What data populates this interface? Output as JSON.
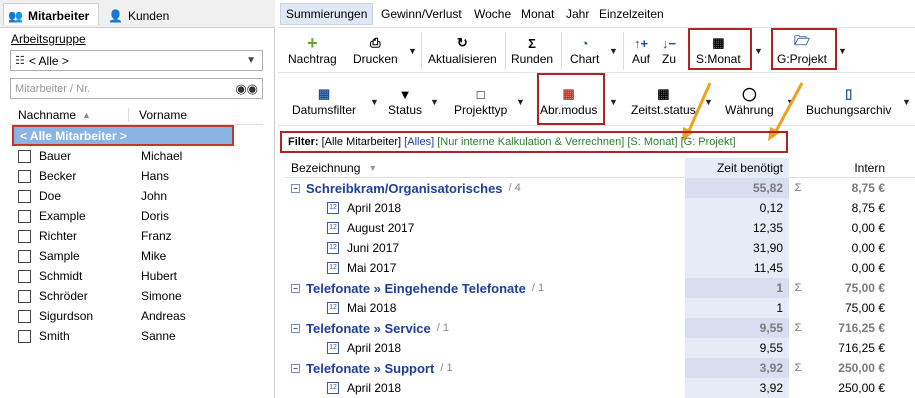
{
  "left": {
    "tabs": [
      {
        "label": "Mitarbeiter",
        "icon": "people-icon"
      },
      {
        "label": "Kunden",
        "icon": "person-icon"
      }
    ],
    "arbeitsgruppe_label": "Arbeitsgruppe",
    "group_select": "< Alle >",
    "search_placeholder": "Mitarbeiter / Nr.",
    "columns": [
      "Nachname",
      "Vorname"
    ],
    "selected": "< Alle Mitarbeiter >",
    "rows": [
      {
        "last": "Bauer",
        "first": "Michael"
      },
      {
        "last": "Becker",
        "first": "Hans"
      },
      {
        "last": "Doe",
        "first": "John"
      },
      {
        "last": "Example",
        "first": "Doris"
      },
      {
        "last": "Richter",
        "first": "Franz"
      },
      {
        "last": "Sample",
        "first": "Mike"
      },
      {
        "last": "Schmidt",
        "first": "Hubert"
      },
      {
        "last": "Schröder",
        "first": "Simone"
      },
      {
        "last": "Sigurdson",
        "first": "Andreas"
      },
      {
        "last": "Smith",
        "first": "Sanne"
      }
    ]
  },
  "right": {
    "tabs": [
      "Summierungen",
      "Gewinn/Verlust",
      "Woche",
      "Monat",
      "Jahr",
      "Einzelzeiten"
    ],
    "toolbar1": {
      "nachtrag": "Nachtrag",
      "drucken": "Drucken",
      "aktualisieren": "Aktualisieren",
      "runden": "Runden",
      "chart": "Chart",
      "auf": "Auf",
      "zu": "Zu",
      "smonat": "S:Monat",
      "gprojekt": "G:Projekt"
    },
    "toolbar2": {
      "datumsfilter": "Datumsfilter",
      "status": "Status",
      "projekttyp": "Projekttyp",
      "abrmodus": "Abr.modus",
      "zeitstatus": "Zeitst.status",
      "waehrung": "Währung",
      "buchungsarchiv": "Buchungsarchiv"
    },
    "filter": {
      "label": "Filter:",
      "f1": "[Alle Mitarbeiter]",
      "f2": "[Alles]",
      "f3": "[Nur interne Kalkulation & Verrechnen]",
      "f4": "[S: Monat]",
      "f5": "[G: Projekt]",
      "colors": {
        "f2": "#1f3f9c",
        "f3": "#2e7d32"
      }
    },
    "table": {
      "headers": [
        "Bezeichnung",
        "Zeit benötigt",
        "Intern"
      ],
      "sigma": "Σ",
      "groups": [
        {
          "name": "Schreibkram/Organisatorisches",
          "count": "/ 4",
          "zeit": "55,82",
          "intern": "8,75 €",
          "rows": [
            {
              "name": "April 2018",
              "zeit": "0,12",
              "intern": "8,75 €"
            },
            {
              "name": "August 2017",
              "zeit": "12,35",
              "intern": "0,00 €"
            },
            {
              "name": "Juni 2017",
              "zeit": "31,90",
              "intern": "0,00 €"
            },
            {
              "name": "Mai 2017",
              "zeit": "11,45",
              "intern": "0,00 €"
            }
          ]
        },
        {
          "name": "Telefonate » Eingehende Telefonate",
          "count": "/ 1",
          "zeit": "1",
          "intern": "75,00 €",
          "rows": [
            {
              "name": "Mai 2018",
              "zeit": "1",
              "intern": "75,00 €"
            }
          ]
        },
        {
          "name": "Telefonate » Service",
          "count": "/ 1",
          "zeit": "9,55",
          "intern": "716,25 €",
          "rows": [
            {
              "name": "April 2018",
              "zeit": "9,55",
              "intern": "716,25 €"
            }
          ]
        },
        {
          "name": "Telefonate » Support",
          "count": "/ 1",
          "zeit": "3,92",
          "intern": "250,00 €",
          "rows": [
            {
              "name": "April 2018",
              "zeit": "3,92",
              "intern": "250,00 €"
            }
          ]
        }
      ]
    }
  }
}
